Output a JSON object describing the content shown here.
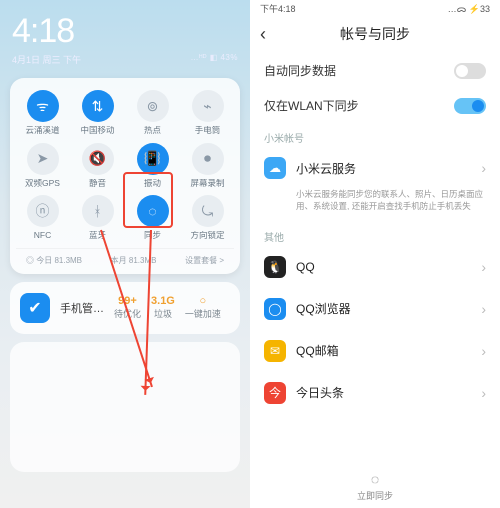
{
  "left": {
    "clock": "4:18",
    "date": "4月1日 周三 下午",
    "signal_text": "…ᴴᴰ ◧ 43%",
    "qs_tiles": [
      {
        "label": "云涌溪道",
        "on": true,
        "glyph": "wifi"
      },
      {
        "label": "中国移动",
        "on": true,
        "glyph": "data"
      },
      {
        "label": "热点",
        "on": false,
        "glyph": "hotspot"
      },
      {
        "label": "手电筒",
        "on": false,
        "glyph": "torch"
      },
      {
        "label": "双频GPS",
        "on": false,
        "glyph": "nav"
      },
      {
        "label": "静音",
        "on": false,
        "glyph": "mute"
      },
      {
        "label": "振动",
        "on": true,
        "glyph": "vibrate"
      },
      {
        "label": "屏幕录制",
        "on": false,
        "glyph": "record"
      },
      {
        "label": "NFC",
        "on": false,
        "glyph": "nfc"
      },
      {
        "label": "蓝牙",
        "on": false,
        "glyph": "bt"
      },
      {
        "label": "同步",
        "on": true,
        "glyph": "sync"
      },
      {
        "label": "方向锁定",
        "on": false,
        "glyph": "lock"
      }
    ],
    "footer_today": "◎ 今日 81.3MB",
    "footer_month": "本月 81.3MB",
    "footer_action": "设置套餐 >",
    "card2_title": "手机管…",
    "card2_metrics": [
      {
        "v": "99+",
        "t": "待优化"
      },
      {
        "v": "3.1G",
        "t": "垃圾"
      },
      {
        "v": "○",
        "t": "一键加速"
      }
    ]
  },
  "right": {
    "status_time": "下午4:18",
    "status_icons": "…ᯅ ⚡33",
    "title": "帐号与同步",
    "auto_sync_label": "自动同步数据",
    "wlan_only_label": "仅在WLAN下同步",
    "section_account": "小米帐号",
    "mi_cloud": "小米云服务",
    "mi_cloud_desc": "小米云服务能同步您的联系人、照片、日历桌面应用、系统设置, 还能开启查找手机防止手机丢失",
    "section_other": "其他",
    "apps": [
      {
        "name": "QQ",
        "color": "#222",
        "glyph": "🐧"
      },
      {
        "name": "QQ浏览器",
        "color": "#1b8df0",
        "glyph": "◯"
      },
      {
        "name": "QQ邮箱",
        "color": "#f5b400",
        "glyph": "✉"
      },
      {
        "name": "今日头条",
        "color": "#e43",
        "glyph": "今"
      }
    ],
    "sync_now": "立即同步"
  }
}
